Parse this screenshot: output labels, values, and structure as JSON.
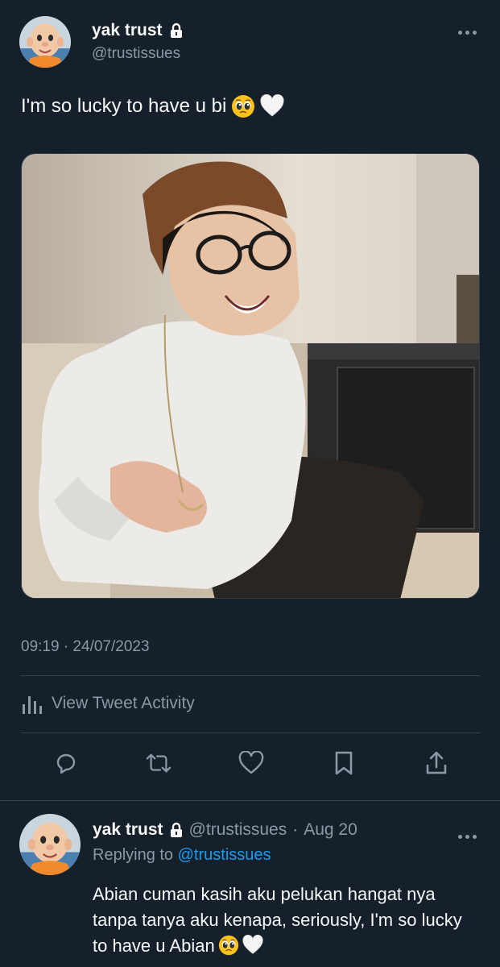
{
  "tweet": {
    "author": {
      "display_name": "yak trust",
      "handle": "@trustissues",
      "protected": true,
      "avatar": "cartoon-boy-avatar"
    },
    "text": "I'm so lucky to have u bi",
    "text_emojis": [
      "pleading-face-emoji",
      "white-heart-emoji"
    ],
    "media": "photo of smiling person in beanie and glasses",
    "timestamp": "09:19 · 24/07/2023",
    "activity_label": "View Tweet Activity",
    "actions": [
      "reply-icon",
      "retweet-icon",
      "like-icon",
      "bookmark-icon",
      "share-icon"
    ]
  },
  "reply": {
    "author": {
      "display_name": "yak trust",
      "handle": "@trustissues",
      "protected": true
    },
    "separator": "·",
    "date": "Aug 20",
    "replying_prefix": "Replying to",
    "replying_to": "@trustissues",
    "text": "Abian cuman kasih aku pelukan hangat nya tanpa tanya aku kenapa, seriously, I'm so lucky to have u Abian",
    "text_emojis": [
      "pleading-face-emoji",
      "white-heart-emoji"
    ]
  },
  "colors": {
    "background": "#15202b",
    "text": "#f7f9f9",
    "secondary": "#8b98a5",
    "link": "#1d9bf0",
    "divider": "#38444d"
  }
}
